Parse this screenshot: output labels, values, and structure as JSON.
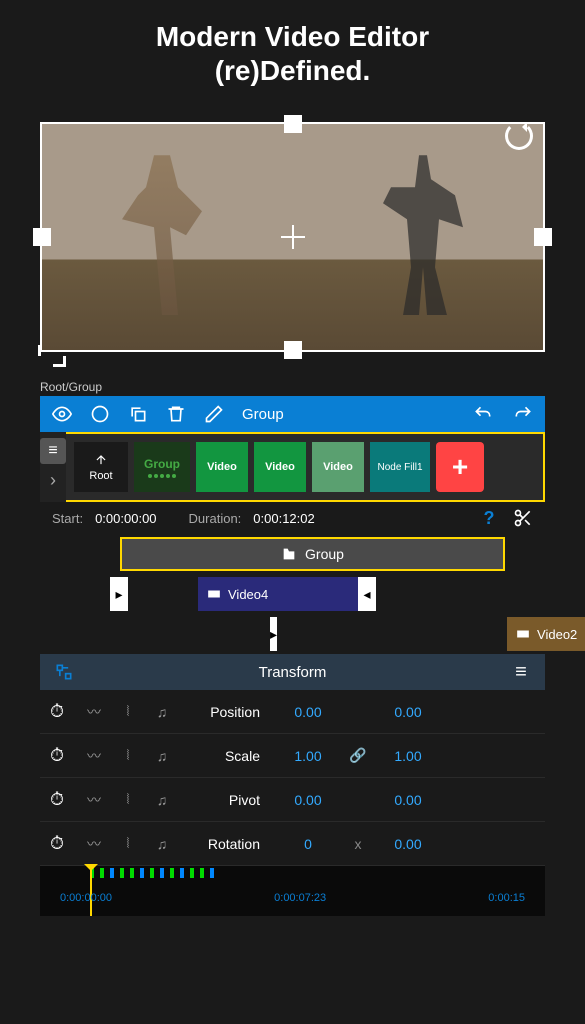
{
  "hero": {
    "line1": "Modern Video Editor",
    "line2": "(re)Defined."
  },
  "breadcrumb": "Root/Group",
  "toolbar": {
    "group_label": "Group"
  },
  "clips": {
    "root_label": "Root",
    "group_label": "Group",
    "video1": "Video",
    "video2": "Video",
    "video3": "Video",
    "node_fill": "Node Fill1",
    "add": "+"
  },
  "timing": {
    "start_label": "Start:",
    "start_value": "0:00:00:00",
    "duration_label": "Duration:",
    "duration_value": "0:00:12:02"
  },
  "tracks": {
    "group_label": "Group",
    "video4_label": "Video4",
    "video2_label": "Video2"
  },
  "transform": {
    "title": "Transform",
    "rows": [
      {
        "label": "Position",
        "val1": "0.00",
        "sep": "",
        "val2": "0.00"
      },
      {
        "label": "Scale",
        "val1": "1.00",
        "sep": "🔗",
        "val2": "1.00"
      },
      {
        "label": "Pivot",
        "val1": "0.00",
        "sep": "",
        "val2": "0.00"
      },
      {
        "label": "Rotation",
        "val1": "0",
        "sep": "x",
        "val2": "0.00"
      }
    ]
  },
  "ruler": {
    "t0": "0:00:00:00",
    "t1": "0:00:07:23",
    "t2": "0:00:15"
  }
}
